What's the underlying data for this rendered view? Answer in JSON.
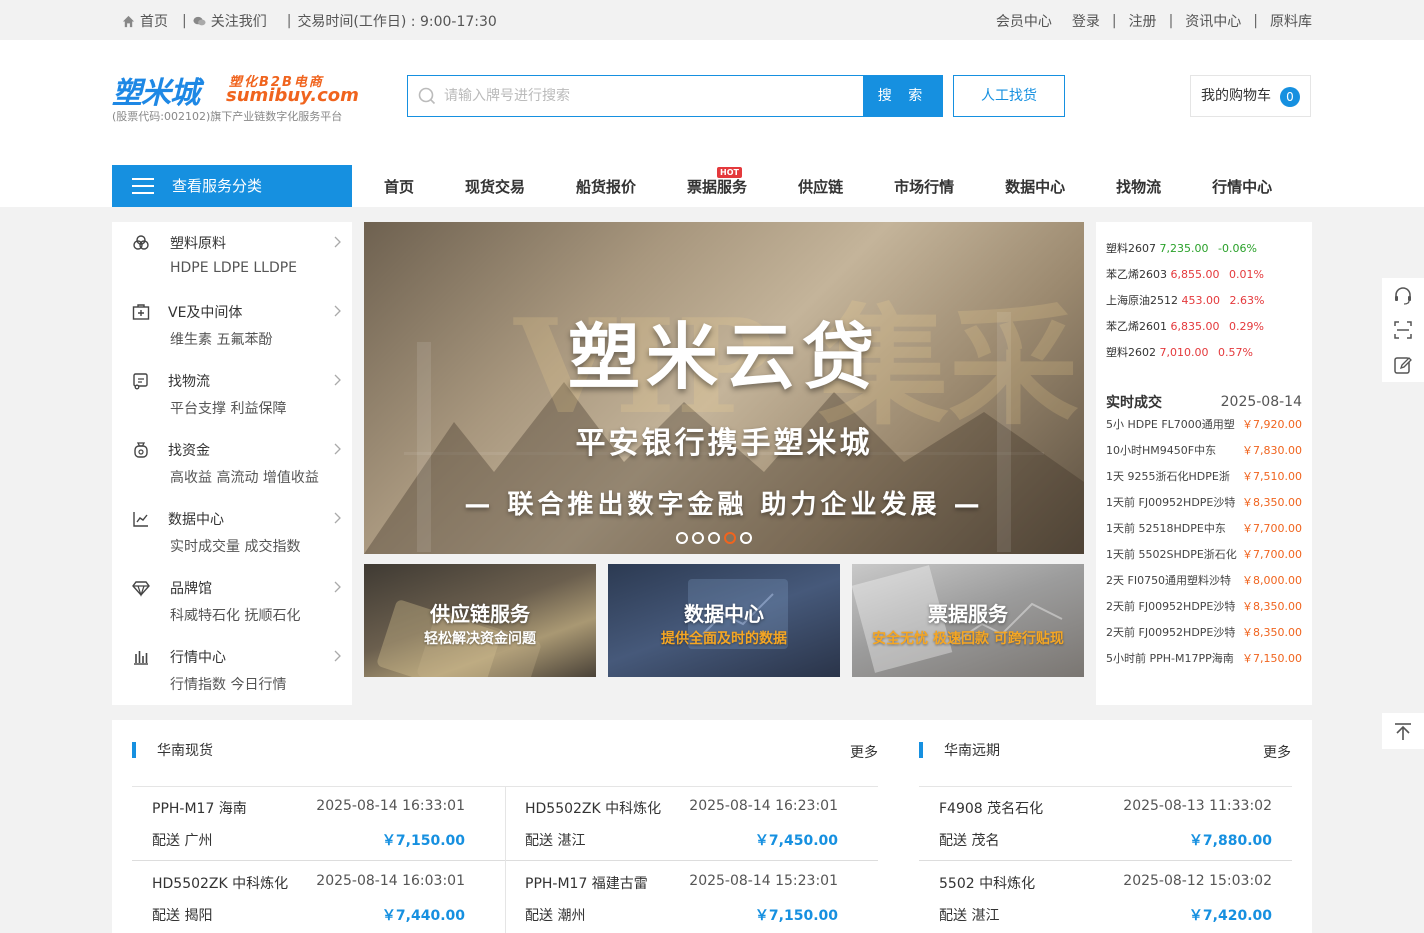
{
  "topbar": {
    "home": "首页",
    "follow": "关注我们",
    "hours": "交易时间(工作日) : 9:00-17:30",
    "member": "会员中心",
    "login": "登录",
    "register": "注册",
    "news": "资讯中心",
    "materials": "原料库"
  },
  "logo": {
    "cn": "塑米城",
    "b2b": "塑化B2B电商",
    "en": "sumibuy.com",
    "sub": "(股票代码:002102)旗下产业链数字化服务平台"
  },
  "search": {
    "placeholder": "请输入牌号进行搜索",
    "button": "搜 索",
    "manual": "人工找货"
  },
  "cart": {
    "label": "我的购物车",
    "count": "0"
  },
  "category_button": "查看服务分类",
  "nav": {
    "items": [
      "首页",
      "现货交易",
      "船货报价",
      "票据服务",
      "供应链",
      "市场行情",
      "数据中心",
      "找物流",
      "行情中心"
    ],
    "hot": "HOT"
  },
  "sidebar": [
    {
      "title": "塑料原料",
      "sub": "HDPE LDPE LLDPE"
    },
    {
      "title": "VE及中间体",
      "sub": "维生素 五氟苯酚"
    },
    {
      "title": "找物流",
      "sub": "平台支撑 利益保障"
    },
    {
      "title": "找资金",
      "sub": "高收益 高流动 增值收益"
    },
    {
      "title": "数据中心",
      "sub": "实时成交量 成交指数"
    },
    {
      "title": "品牌馆",
      "sub": "科威特石化 抚顺石化"
    },
    {
      "title": "行情中心",
      "sub": "行情指数 今日行情"
    }
  ],
  "banner": {
    "watermark": "VIP 集采",
    "title": "塑米云贷",
    "line2": "平安银行携手塑米城",
    "line3": "— 联合推出数字金融 助力企业发展 —",
    "active_slide": 4,
    "slides": 5
  },
  "promos": [
    {
      "title": "供应链服务",
      "sub": "轻松解决资金问题",
      "sub_color": "#ffffff"
    },
    {
      "title": "数据中心",
      "sub": "提供全面及时的数据",
      "sub_color": "#f5a623"
    },
    {
      "title": "票据服务",
      "sub": "安全无忧 极速回款 可跨行贴现",
      "sub_color": "#f5a623"
    }
  ],
  "tickers": [
    {
      "name": "塑料2607",
      "price": "7,235.00",
      "change": "-0.06%",
      "up": false
    },
    {
      "name": "苯乙烯2603",
      "price": "6,855.00",
      "change": "0.01%",
      "up": true
    },
    {
      "name": "上海原油2512",
      "price": "453.00",
      "change": "2.63%",
      "up": true
    },
    {
      "name": "苯乙烯2601",
      "price": "6,835.00",
      "change": "0.29%",
      "up": true
    },
    {
      "name": "塑料2602",
      "price": "7,010.00",
      "change": "0.57%",
      "up": true
    }
  ],
  "trades": {
    "title": "实时成交",
    "date": "2025-08-14",
    "rows": [
      {
        "text": "5小  HDPE FL7000通用塑",
        "price": "￥7,920.00"
      },
      {
        "text": "10小时HM9450F中东",
        "price": "￥7,830.00"
      },
      {
        "text": "1天  9255浙石化HDPE浙",
        "price": "￥7,510.00"
      },
      {
        "text": "1天前  FJ00952HDPE沙特",
        "price": "￥8,350.00"
      },
      {
        "text": "1天前   52518HDPE中东",
        "price": "￥7,700.00"
      },
      {
        "text": "1天前  5502SHDPE浙石化",
        "price": "￥7,700.00"
      },
      {
        "text": "2天  FI0750通用塑料沙特",
        "price": "￥8,000.00"
      },
      {
        "text": "2天前  FJ00952HDPE沙特",
        "price": "￥8,350.00"
      },
      {
        "text": "2天前  FJ00952HDPE沙特",
        "price": "￥8,350.00"
      },
      {
        "text": "5小时前  PPH-M17PP海南",
        "price": "￥7,150.00"
      }
    ]
  },
  "south_spot": {
    "title": "华南现货",
    "more": "更多",
    "cards": [
      {
        "product": "PPH-M17  海南",
        "time": "2025-08-14 16:33:01",
        "delivery": "配送  广州",
        "price": "￥7,150.00"
      },
      {
        "product": "HD5502ZK  中科炼化",
        "time": "2025-08-14 16:23:01",
        "delivery": "配送  湛江",
        "price": "￥7,450.00"
      },
      {
        "product": "HD5502ZK  中科炼化",
        "time": "2025-08-14 16:03:01",
        "delivery": "配送  揭阳",
        "price": "￥7,440.00"
      },
      {
        "product": "PPH-M17  福建古雷",
        "time": "2025-08-14 15:23:01",
        "delivery": "配送  潮州",
        "price": "￥7,150.00"
      }
    ]
  },
  "south_future": {
    "title": "华南远期",
    "more": "更多",
    "cards": [
      {
        "product": "F4908  茂名石化",
        "time": "2025-08-13 11:33:02",
        "delivery": "配送  茂名",
        "price": "￥7,880.00"
      },
      {
        "product": "5502  中科炼化",
        "time": "2025-08-12 15:03:02",
        "delivery": "配送  湛江",
        "price": "￥7,420.00"
      }
    ]
  },
  "colors": {
    "accent": "#1690e0",
    "orange": "#f0641e",
    "up": "#e4393c",
    "down": "#2aa12a"
  }
}
